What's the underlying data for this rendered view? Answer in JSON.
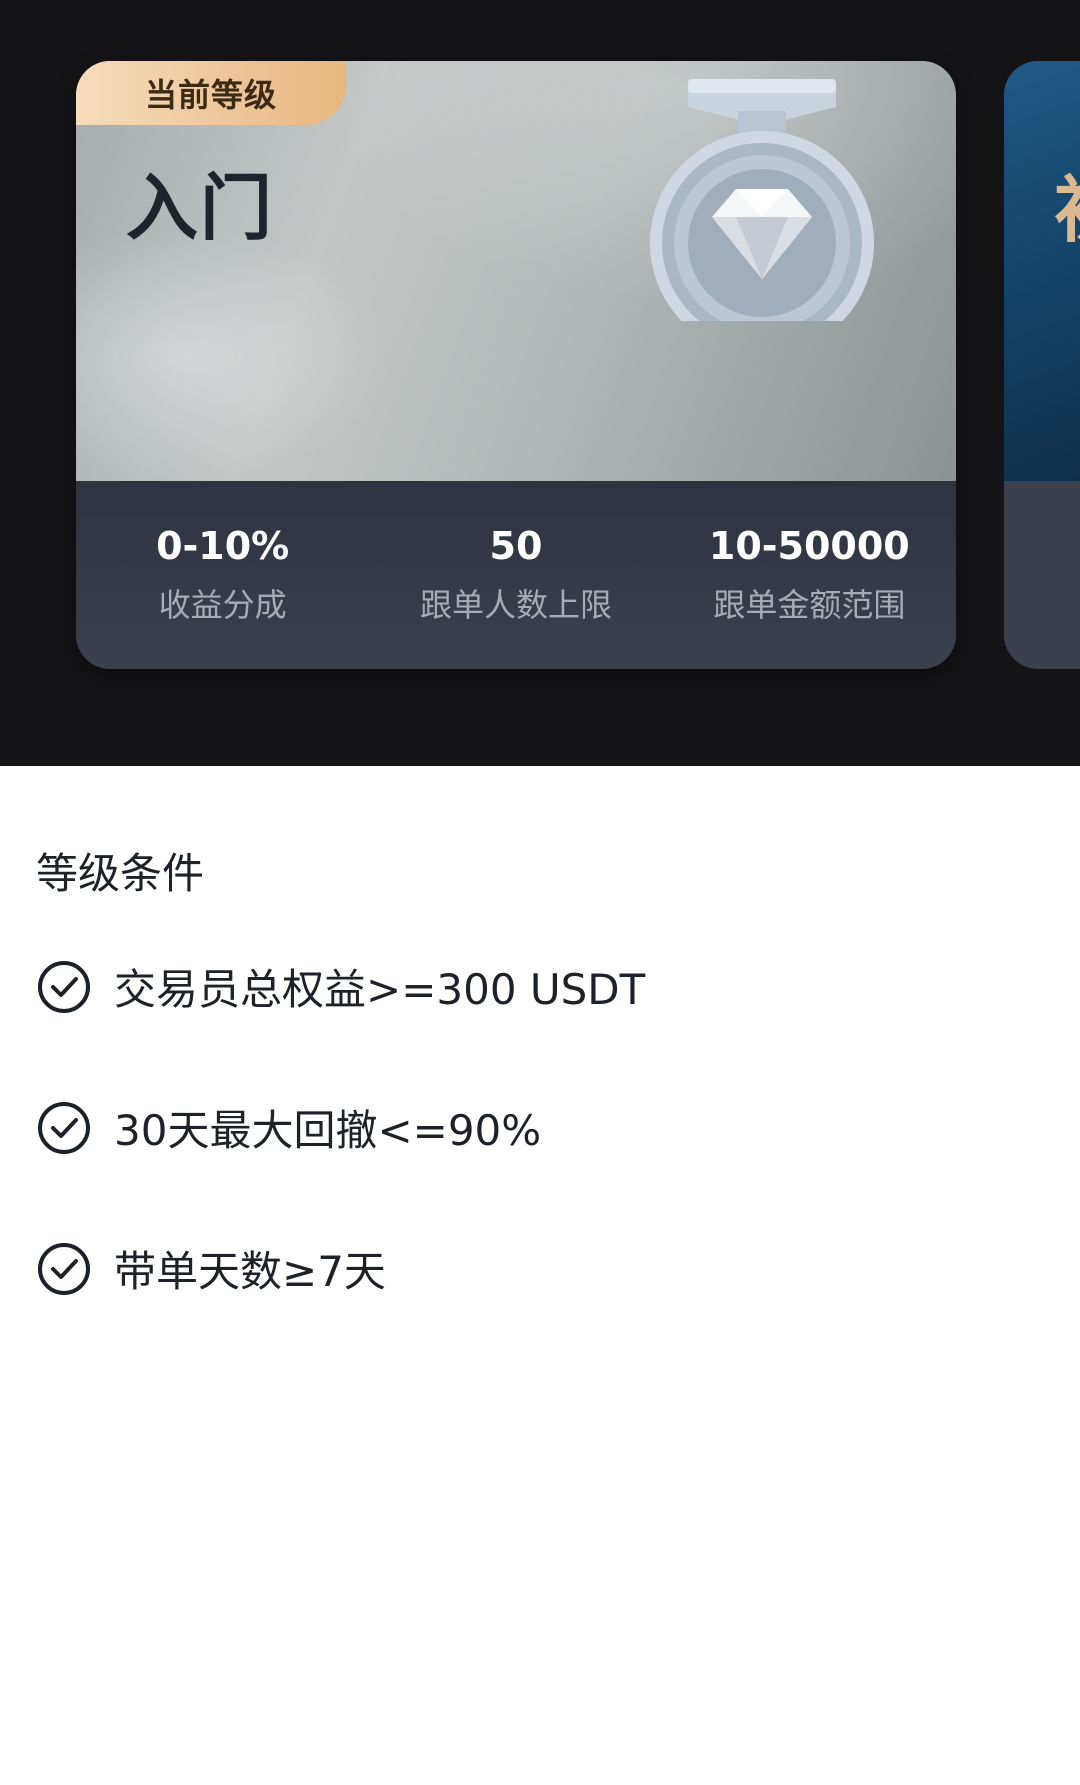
{
  "level_card": {
    "badge_label": "当前等级",
    "level_name": "入门",
    "medal_icon": "diamond-medal-icon",
    "stats": [
      {
        "value": "0-10%",
        "label": "收益分成"
      },
      {
        "value": "50",
        "label": "跟单人数上限"
      },
      {
        "value": "10-50000",
        "label": "跟单金额范围"
      }
    ]
  },
  "next_card": {
    "level_name_visible": "初"
  },
  "conditions": {
    "title": "等级条件",
    "items": [
      {
        "text": "交易员总权益>=300 USDT",
        "icon": "check-circle-icon"
      },
      {
        "text": "30天最大回撤<=90%",
        "icon": "check-circle-icon"
      },
      {
        "text": "带单天数≥7天",
        "icon": "check-circle-icon"
      }
    ]
  },
  "colors": {
    "hero_bg": "#141416",
    "badge_gradient_start": "#f6dcbc",
    "badge_gradient_end": "#e8b67f",
    "stats_bg": "#2f3542",
    "next_card_blue": "#1f5a86"
  }
}
